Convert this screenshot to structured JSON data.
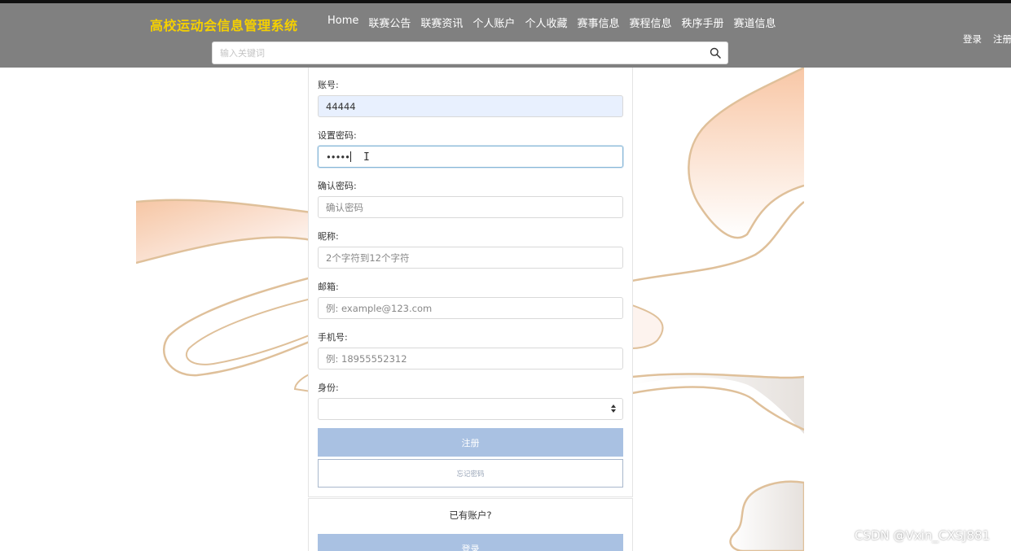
{
  "header": {
    "brand": "高校运动会信息管理系统",
    "nav": [
      "Home",
      "联赛公告",
      "联赛资讯",
      "个人账户",
      "个人收藏",
      "赛事信息",
      "赛程信息",
      "秩序手册",
      "赛道信息"
    ],
    "login": "登录",
    "register": "注册",
    "search_placeholder": "输入关键词",
    "search_icon": "search-icon"
  },
  "form": {
    "account_label": "账号:",
    "account_value": "44444",
    "password_label": "设置密码:",
    "password_value": "•••••",
    "confirm_label": "确认密码:",
    "confirm_placeholder": "确认密码",
    "nickname_label": "昵称:",
    "nickname_placeholder": "2个字符到12个字符",
    "email_label": "邮箱:",
    "email_placeholder": "例: example@123.com",
    "phone_label": "手机号:",
    "phone_placeholder": "例: 18955552312",
    "identity_label": "身份:",
    "identity_value": "",
    "register_button": "注册",
    "forgot_button": "忘记密码"
  },
  "footer_card": {
    "have_account": "已有账户?",
    "login_button": "登录"
  },
  "watermark": "CSDN @Vxin_CXSJ881",
  "colors": {
    "navbar": "#808080",
    "brand": "#f5d000",
    "button": "#a9c1e2",
    "swirl_stroke": "#dfc09a"
  }
}
